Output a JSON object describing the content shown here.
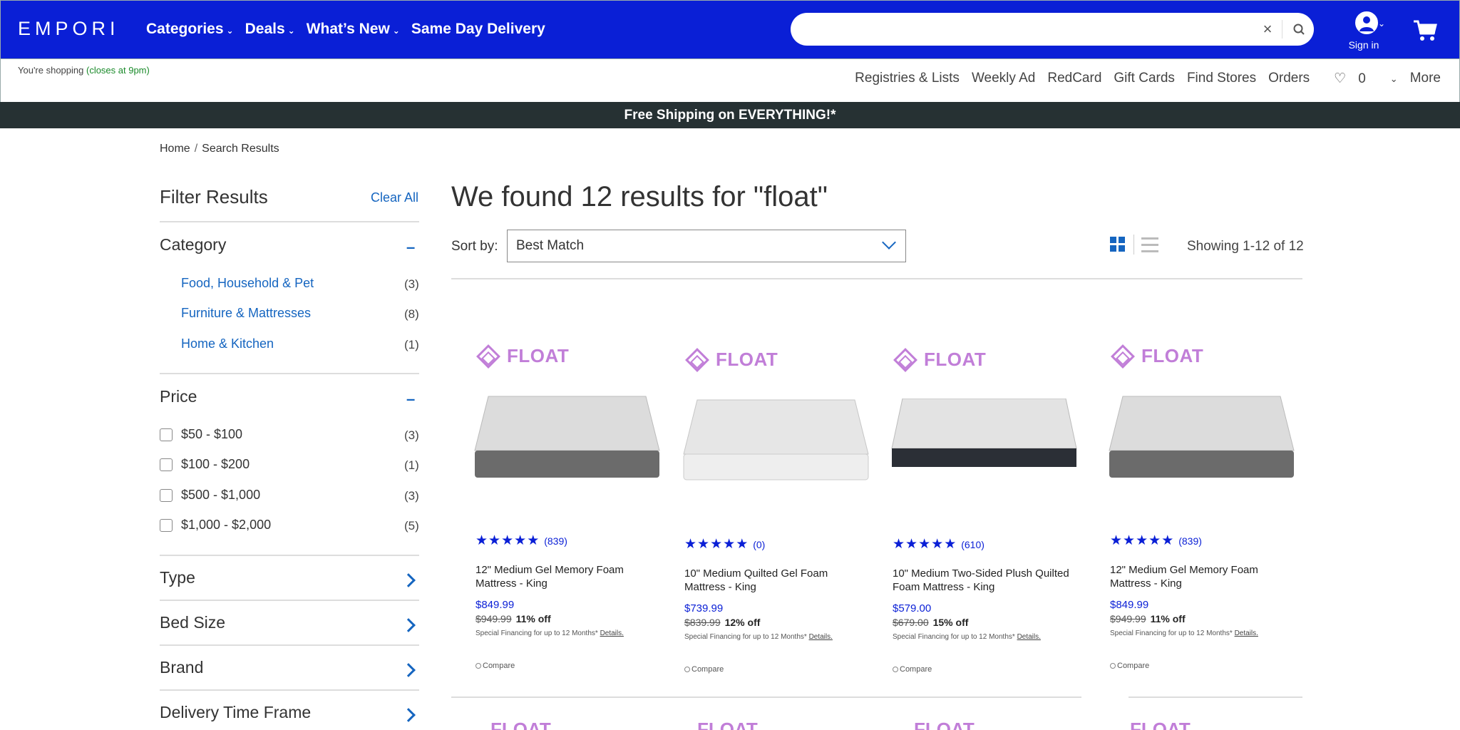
{
  "header": {
    "logo": "EMPORI",
    "nav": [
      "Categories",
      "Deals",
      "What’s New",
      "Same Day Delivery"
    ],
    "search_value": "",
    "sign_in": "Sign in"
  },
  "subheader": {
    "shopping_prefix": "You're shopping",
    "shopping_hours": "(closes at 9pm)",
    "links": [
      "Registries & Lists",
      "Weekly Ad",
      "RedCard",
      "Gift Cards",
      "Find Stores",
      "Orders"
    ],
    "favorites_count": "0",
    "more": "More"
  },
  "banner": "Free Shipping on EVERYTHING!*",
  "breadcrumb": {
    "home": "Home",
    "current": "Search Results"
  },
  "filters": {
    "title": "Filter Results",
    "clear_all": "Clear All",
    "category_title": "Category",
    "categories": [
      {
        "label": "Food, Household & Pet",
        "count": "(3)"
      },
      {
        "label": "Furniture & Mattresses",
        "count": "(8)"
      },
      {
        "label": "Home & Kitchen",
        "count": "(1)"
      }
    ],
    "price_title": "Price",
    "prices": [
      {
        "label": "$50 - $100",
        "count": "(3)"
      },
      {
        "label": "$100 - $200",
        "count": "(1)"
      },
      {
        "label": "$500 - $1,000",
        "count": "(3)"
      },
      {
        "label": "$1,000 - $2,000",
        "count": "(5)"
      }
    ],
    "collapsed": [
      "Type",
      "Bed Size",
      "Brand",
      "Delivery Time Frame"
    ]
  },
  "results": {
    "title": "We found 12 results for \"float\"",
    "sort_label": "Sort by:",
    "sort_value": "Best Match",
    "showing": "Showing 1-12 of 12"
  },
  "products": [
    {
      "brand": "FLOAT",
      "rating_count": "(839)",
      "name": "12\" Medium Gel Memory Foam Mattress  - King",
      "price": "$849.99",
      "was": "$949.99",
      "off": "11% off",
      "finance": "Special Financing for up to 12 Months*",
      "details": "Details.",
      "compare": "Compare"
    },
    {
      "brand": "FLOAT",
      "rating_count": "(0)",
      "name": "10\" Medium Quilted Gel Foam Mattress  - King",
      "price": "$739.99",
      "was": "$839.99",
      "off": "12% off",
      "finance": "Special Financing for up to 12 Months*",
      "details": "Details.",
      "compare": "Compare"
    },
    {
      "brand": "FLOAT",
      "rating_count": "(610)",
      "name": "10\" Medium Two-Sided Plush Quilted Foam Mattress  - King",
      "price": "$579.00",
      "was": "$679.00",
      "off": "15% off",
      "finance": "Special Financing for up to 12 Months*",
      "details": "Details.",
      "compare": "Compare"
    },
    {
      "brand": "FLOAT",
      "rating_count": "(839)",
      "name": "12\" Medium Gel Memory Foam Mattress  - King",
      "price": "$849.99",
      "was": "$949.99",
      "off": "11% off",
      "finance": "Special Financing for up to 12 Months*",
      "details": "Details.",
      "compare": "Compare"
    }
  ],
  "colors": {
    "brand_blue": "#0a1fd6",
    "banner_dark": "#263133",
    "link_blue": "#1565c0",
    "float_purple": "#c17ed8"
  }
}
